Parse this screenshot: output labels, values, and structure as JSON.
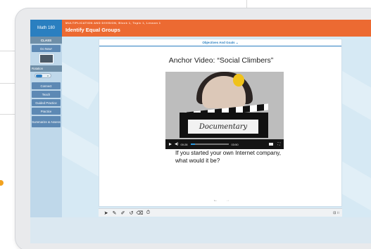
{
  "header": {
    "brand": "Math 180",
    "breadcrumb": "MULTIPLICATION AND DIVISION, Block 1, Topic 1, Lesson 1",
    "title": "Identify Equal Groups"
  },
  "sidebar": {
    "class_label": "CLASS",
    "do_now": "Do Now!",
    "rotation_label": "Rotation",
    "items": [
      {
        "label": "Connect"
      },
      {
        "label": "Teach"
      },
      {
        "label": "Guided Practice"
      },
      {
        "label": "Practice"
      },
      {
        "label": "Summarize & Assess"
      }
    ]
  },
  "slide": {
    "objectives_label": "Objectives And Goals ⌄",
    "title": "Anchor Video: “Social Climbers”",
    "video": {
      "clapper_text": "Documentary",
      "time_current": "00:28",
      "time_total": "03:50",
      "progress": 0.12
    },
    "question": "If you started your own Internet company, what would it be?",
    "nav_prev": "←",
    "nav_next": "→"
  },
  "toolbar": {
    "tools": [
      "pointer-icon",
      "pen-icon",
      "highlighter-icon",
      "undo-icon",
      "eraser-icon",
      "timer-icon"
    ],
    "tool_glyphs": [
      "➤",
      "✎",
      "✐",
      "↺",
      "⌫",
      "⏱"
    ],
    "right_glyph": "⊡ ⁝⁝"
  },
  "colors": {
    "topbar": "#ec6a32",
    "brand": "#2a7fc0",
    "sidebar_button": "#5d89b4",
    "accent": "#2a7fc0"
  }
}
